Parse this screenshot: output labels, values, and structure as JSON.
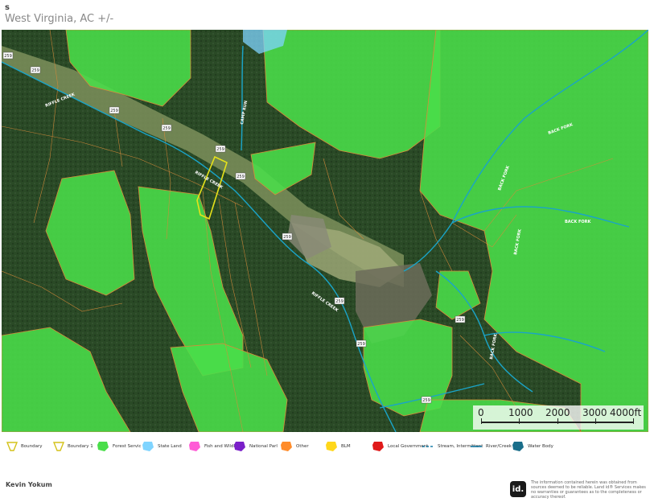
{
  "header": {
    "title": "s",
    "subtitle": "West Virginia,  AC +/-"
  },
  "map": {
    "road_labels": [
      "259",
      "259",
      "259",
      "259",
      "259",
      "259",
      "259",
      "259",
      "259",
      "259",
      "259"
    ],
    "stream_labels": [
      "RIFFLE CREEK",
      "RIFFLE CREEK",
      "RIFFLE CREEK",
      "BACK FORK",
      "BACK FORK",
      "BACK FORK",
      "BACK FORK",
      "BACK FORK",
      "CAMP RUN"
    ],
    "colors": {
      "forest_service": "#4ade4a",
      "imagery_dark": "#1f3d1f",
      "imagery_mid": "#355a2c",
      "clearing": "#8f9e6a",
      "stream": "#1aa4c8",
      "parcel_line": "#d88a3a",
      "boundary": "#e6e21a",
      "state_land": "#7fd4ff"
    }
  },
  "scale": {
    "labels": [
      "0",
      "1000",
      "2000",
      "3000",
      "4000ft"
    ]
  },
  "legend": [
    {
      "label": "Boundary",
      "icon": "boundary-outline-icon",
      "color": "#d4c21a"
    },
    {
      "label": "Boundary 1",
      "icon": "boundary-outline-icon",
      "color": "#d4c21a"
    },
    {
      "label": "Forest Servic",
      "icon": "polygon-icon",
      "color": "#4ade4a"
    },
    {
      "label": "State Land",
      "icon": "polygon-icon",
      "color": "#7fd4ff"
    },
    {
      "label": "Fish and Wildlife",
      "icon": "polygon-icon",
      "color": "#ff5cd6"
    },
    {
      "label": "National Parl",
      "icon": "polygon-icon",
      "color": "#7a1fc9"
    },
    {
      "label": "Other",
      "icon": "polygon-icon",
      "color": "#ff8c2a"
    },
    {
      "label": "BLM",
      "icon": "polygon-icon",
      "color": "#ffd71a"
    },
    {
      "label": "Local Government",
      "icon": "polygon-icon",
      "color": "#e01a1a"
    },
    {
      "label": "Stream, Intermittent",
      "icon": "dashed-line-icon",
      "color": "#1a7fa8"
    },
    {
      "label": "River/Creek",
      "icon": "line-icon",
      "color": "#1a7fa8"
    },
    {
      "label": "Water Body",
      "icon": "polygon-icon",
      "color": "#1a6e8a"
    }
  ],
  "footer": {
    "name": "Kevin Yokum",
    "logo_text": "id.",
    "disclaimer": "The information contained herein was obtained from sources deemed to be reliable. Land id® Services makes no warranties or guarantees as to the completeness or accuracy thereof."
  }
}
